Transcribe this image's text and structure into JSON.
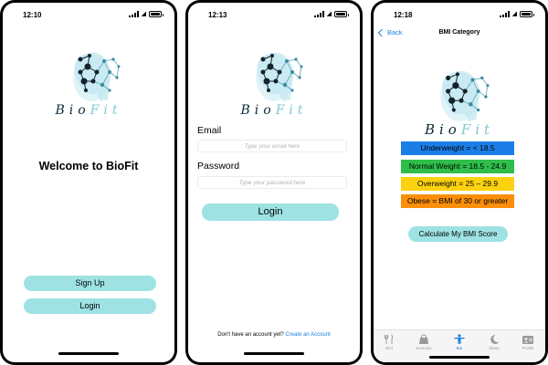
{
  "screens": {
    "welcome": {
      "time": "12:10",
      "brand": {
        "first": "Bio",
        "second": "Fit"
      },
      "heading": "Welcome to BioFit",
      "signup_label": "Sign Up",
      "login_label": "Login"
    },
    "login": {
      "time": "12:13",
      "brand": {
        "first": "Bio",
        "second": "Fit"
      },
      "email_label": "Email",
      "email_placeholder": "Type your email here",
      "email_value": "",
      "password_label": "Password",
      "password_placeholder": "Type your password here",
      "password_value": "",
      "login_label": "Login",
      "account_prompt": "Don't have an account yet?",
      "create_account_label": "Create an Account"
    },
    "bmi": {
      "time": "12:18",
      "back_label": "Back",
      "title": "BMI Category",
      "brand": {
        "first": "Bio",
        "second": "Fit"
      },
      "categories": [
        {
          "label": "Underweight = < 18.5",
          "color": "#1b7ee6"
        },
        {
          "label": "Normal Weight =  18.5 - 24.9",
          "color": "#2fbe4a"
        },
        {
          "label": "Overweight = 25 – 29.9",
          "color": "#fcd210"
        },
        {
          "label": "Obese = BMI of 30 or greater",
          "color": "#fc8f0a"
        }
      ],
      "calculate_label": "Calculate My BMI Score",
      "tabs": [
        {
          "label": "Diet",
          "icon": "fork-knife-icon"
        },
        {
          "label": "Exercise",
          "icon": "kettlebell-icon"
        },
        {
          "label": "Bio",
          "icon": "body-icon",
          "active": true
        },
        {
          "label": "Sleep",
          "icon": "moon-icon"
        },
        {
          "label": "Profile",
          "icon": "id-card-icon"
        }
      ]
    }
  },
  "colors": {
    "accent_teal": "#9ee2e4",
    "link_blue": "#1a7fe0",
    "logo_dark": "#0a2a3a",
    "logo_light": "#7fc9d2"
  }
}
